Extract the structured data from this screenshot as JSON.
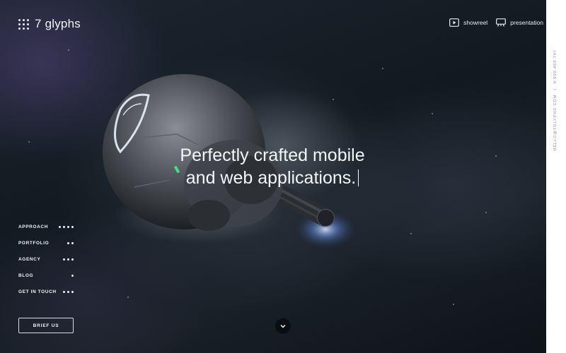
{
  "logo": {
    "text": "7 glyphs"
  },
  "topnav": [
    {
      "label": "showreel",
      "icon": "play-icon"
    },
    {
      "label": "presentation",
      "icon": "presentation-icon"
    }
  ],
  "contact": {
    "email": "HELLO@7GLYPHS.COM",
    "separator": "|",
    "phone": "0 800 459 747"
  },
  "headline": {
    "line1": "Perfectly crafted mobile",
    "line2": "and web applications."
  },
  "menu": [
    {
      "label": "APPROACH",
      "dots": 4
    },
    {
      "label": "PORTFOLIO",
      "dots": 2
    },
    {
      "label": "AGENCY",
      "dots": 3
    },
    {
      "label": "BLOG",
      "dots": 1
    },
    {
      "label": "GET IN TOUCH",
      "dots": 3
    }
  ],
  "cta": {
    "label": "BRIEF US"
  },
  "scroll": {
    "icon": "chevron-down-icon"
  }
}
